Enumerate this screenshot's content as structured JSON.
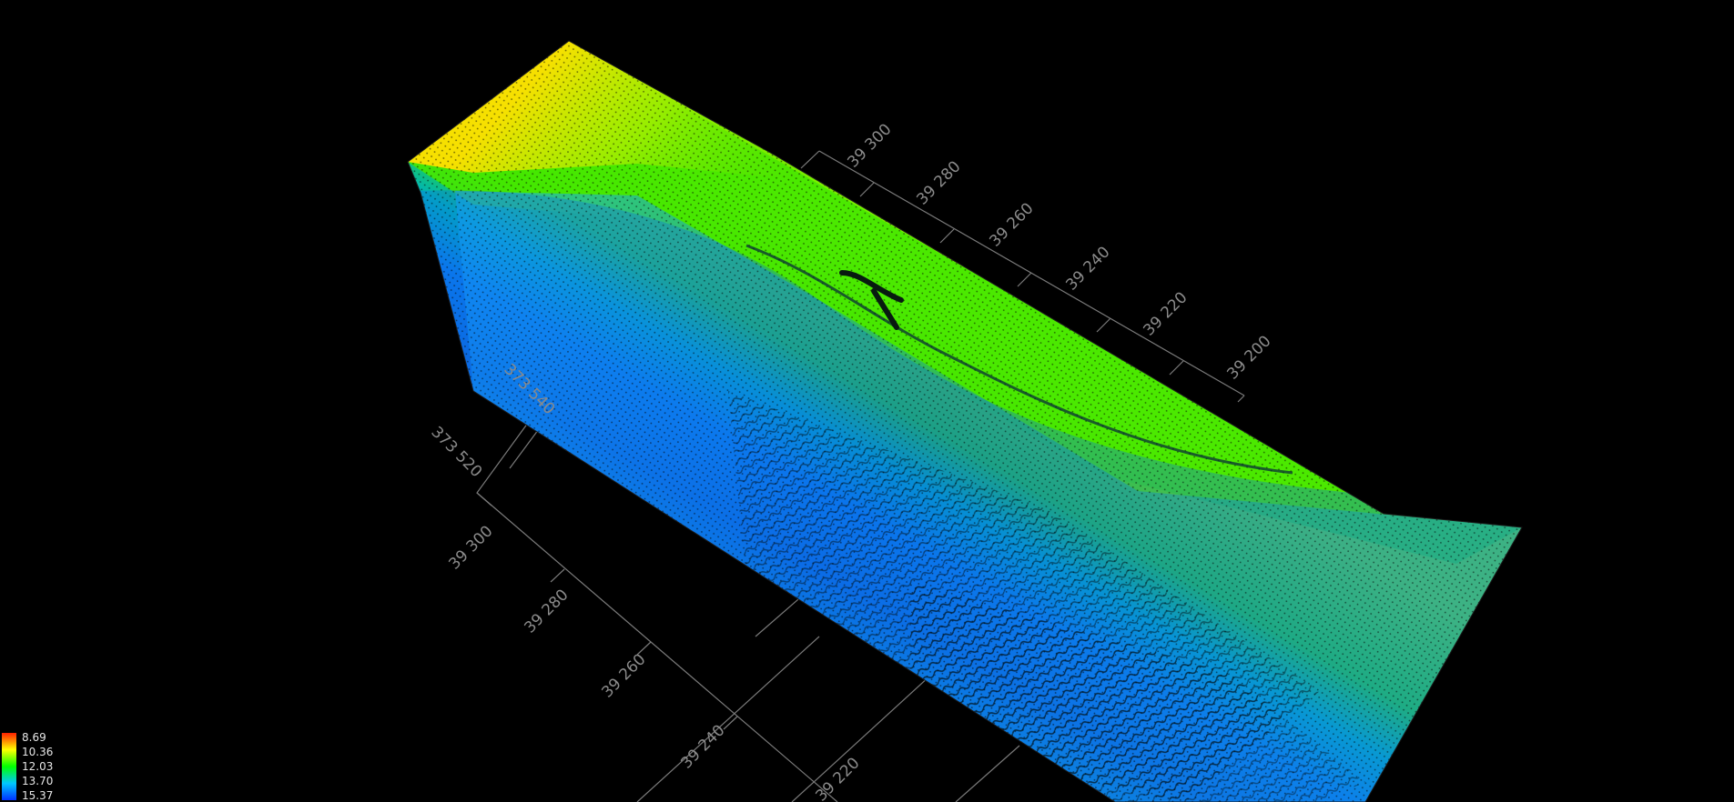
{
  "scene": {
    "type": "3d-point-cloud-bathymetry",
    "background": "#000000",
    "colormap": [
      "#ff2000",
      "#ffff00",
      "#00ff00",
      "#00c8ff",
      "#0032ff"
    ],
    "grid_color": "#7a7a7a"
  },
  "axes": {
    "right_labels": [
      "39 300",
      "39 280",
      "39 260",
      "39 240",
      "39 220",
      "39 200"
    ],
    "left_top_labels": [
      "373 540",
      "373 520"
    ],
    "left_bottom_labels": [
      "39 300",
      "39 280",
      "39 260",
      "39 240",
      "39 220"
    ]
  },
  "legend": {
    "values": [
      "8.69",
      "10.36",
      "12.03",
      "13.70",
      "15.37"
    ],
    "colors": [
      "#ff2000",
      "#ffff00",
      "#00ff00",
      "#00c8ff",
      "#0032ff"
    ]
  }
}
